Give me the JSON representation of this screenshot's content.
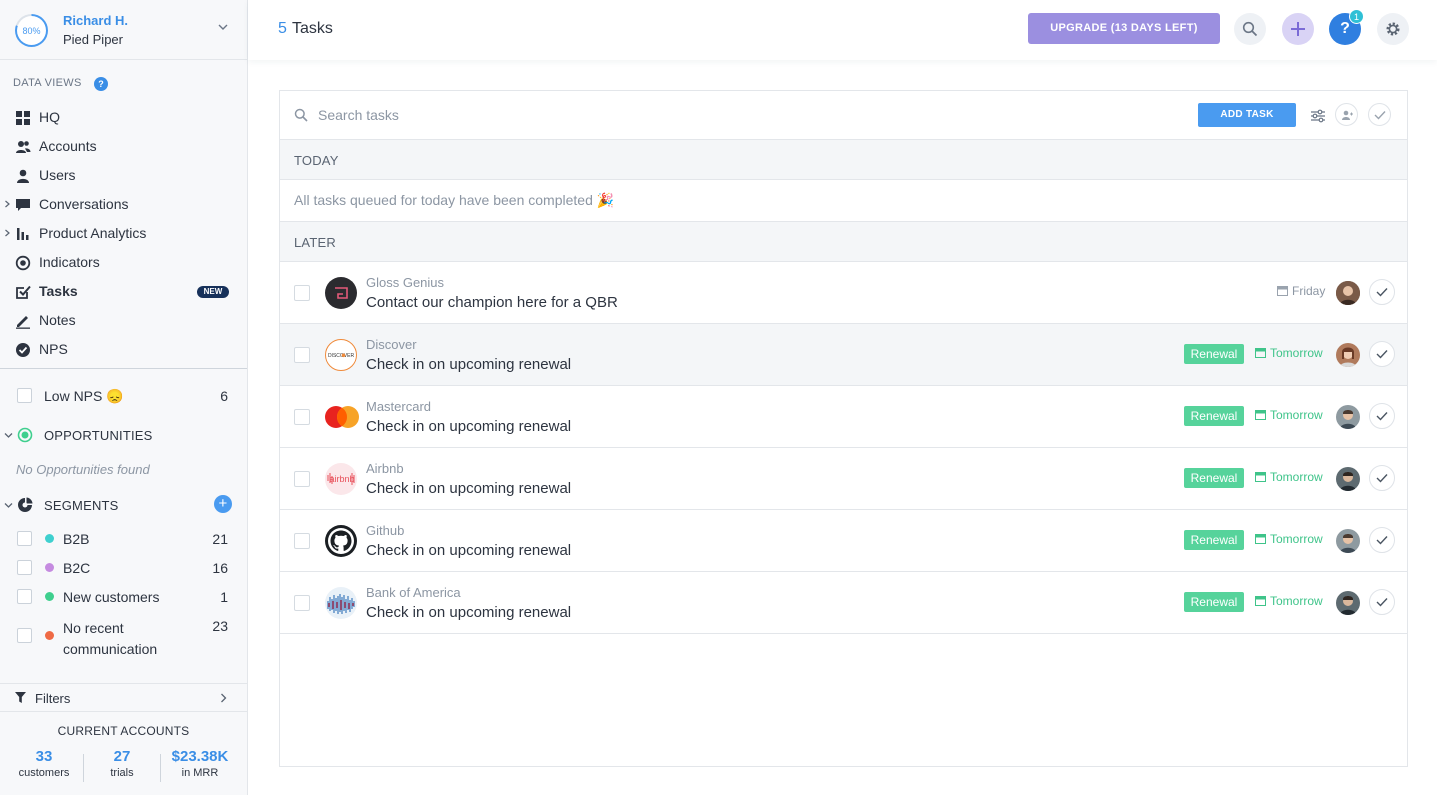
{
  "user": {
    "progress": "80%",
    "name": "Richard H.",
    "org": "Pied Piper"
  },
  "sidebar": {
    "data_views_label": "DATA VIEWS",
    "help": "?",
    "nav": [
      {
        "label": "HQ",
        "icon": "grid-icon"
      },
      {
        "label": "Accounts",
        "icon": "accounts-icon"
      },
      {
        "label": "Users",
        "icon": "user-icon"
      },
      {
        "label": "Conversations",
        "icon": "chat-icon"
      },
      {
        "label": "Product Analytics",
        "icon": "bar-chart-icon"
      },
      {
        "label": "Indicators",
        "icon": "target-icon"
      },
      {
        "label": "Tasks",
        "icon": "checkbox-icon",
        "badge": "NEW"
      },
      {
        "label": "Notes",
        "icon": "pencil-icon"
      },
      {
        "label": "NPS",
        "icon": "check-circle-icon"
      }
    ],
    "low_nps": {
      "label": "Low NPS 😞",
      "count": "6"
    },
    "opportunities": {
      "title": "OPPORTUNITIES",
      "empty": "No Opportunities found"
    },
    "segments": {
      "title": "SEGMENTS",
      "items": [
        {
          "label": "B2B",
          "count": "21",
          "color": "#3fd0cf"
        },
        {
          "label": "B2C",
          "count": "16",
          "color": "#c58be0"
        },
        {
          "label": "New customers",
          "count": "1",
          "color": "#3fcf8e"
        },
        {
          "label": "No recent communication",
          "count": "23",
          "color": "#ef6a45"
        }
      ]
    },
    "filters_label": "Filters",
    "current_accounts": {
      "title": "CURRENT ACCOUNTS",
      "stats": [
        {
          "value": "33",
          "label": "customers"
        },
        {
          "value": "27",
          "label": "trials"
        },
        {
          "value": "$23.38K",
          "label": "in MRR"
        }
      ]
    }
  },
  "header": {
    "count": "5",
    "title": "Tasks",
    "upgrade": "UPGRADE (13 DAYS LEFT)",
    "notifications": "1",
    "help": "?"
  },
  "tasks": {
    "search_placeholder": "Search tasks",
    "add_task": "ADD TASK",
    "today_label": "TODAY",
    "today_message": "All tasks queued for today have been completed 🎉",
    "later_label": "LATER",
    "items": [
      {
        "account": "Gloss Genius",
        "title": "Contact our champion here for a QBR",
        "tag": "",
        "due": "Friday"
      },
      {
        "account": "Discover",
        "title": "Check in on upcoming renewal",
        "tag": "Renewal",
        "due": "Tomorrow"
      },
      {
        "account": "Mastercard",
        "title": "Check in on upcoming renewal",
        "tag": "Renewal",
        "due": "Tomorrow"
      },
      {
        "account": "Airbnb",
        "title": "Check in on upcoming renewal",
        "tag": "Renewal",
        "due": "Tomorrow"
      },
      {
        "account": "Github",
        "title": "Check in on upcoming renewal",
        "tag": "Renewal",
        "due": "Tomorrow"
      },
      {
        "account": "Bank of America",
        "title": "Check in on upcoming renewal",
        "tag": "Renewal",
        "due": "Tomorrow"
      }
    ]
  },
  "colors": {
    "accent": "#3a8ee6",
    "renewal": "#56d39b",
    "upgrade": "#9b8fe0"
  }
}
